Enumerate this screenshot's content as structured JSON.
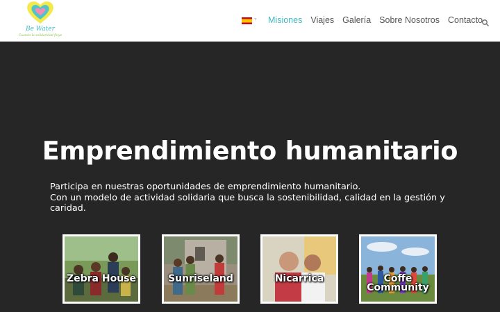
{
  "brand": {
    "name": "Be Water",
    "tagline": "Cuando la solidaridad fluye"
  },
  "language": {
    "selected": "ES",
    "flag_colors": [
      "#c60b1e",
      "#ffc400"
    ]
  },
  "nav": {
    "items": [
      {
        "label": "Misiones",
        "active": true
      },
      {
        "label": "Viajes",
        "active": false
      },
      {
        "label": "Galería",
        "active": false
      },
      {
        "label": "Sobre Nosotros",
        "active": false
      },
      {
        "label": "Contacto",
        "active": false
      }
    ],
    "search_icon": "search-icon"
  },
  "hero": {
    "title": "Emprendimiento humanitario",
    "line1": "Participa en nuestras oportunidades de emprendimiento humanitario.",
    "line2": "Con un modelo de actividad solidaria que busca la sostenibilidad, calidad en la gestión y caridad."
  },
  "projects": [
    {
      "title": "Zebra House"
    },
    {
      "title": "Sunriseland"
    },
    {
      "title": "Nicarrica"
    },
    {
      "title": "Coffe Community"
    }
  ],
  "colors": {
    "accent": "#3db9c2",
    "background": "#262626",
    "header": "#ffffff"
  }
}
